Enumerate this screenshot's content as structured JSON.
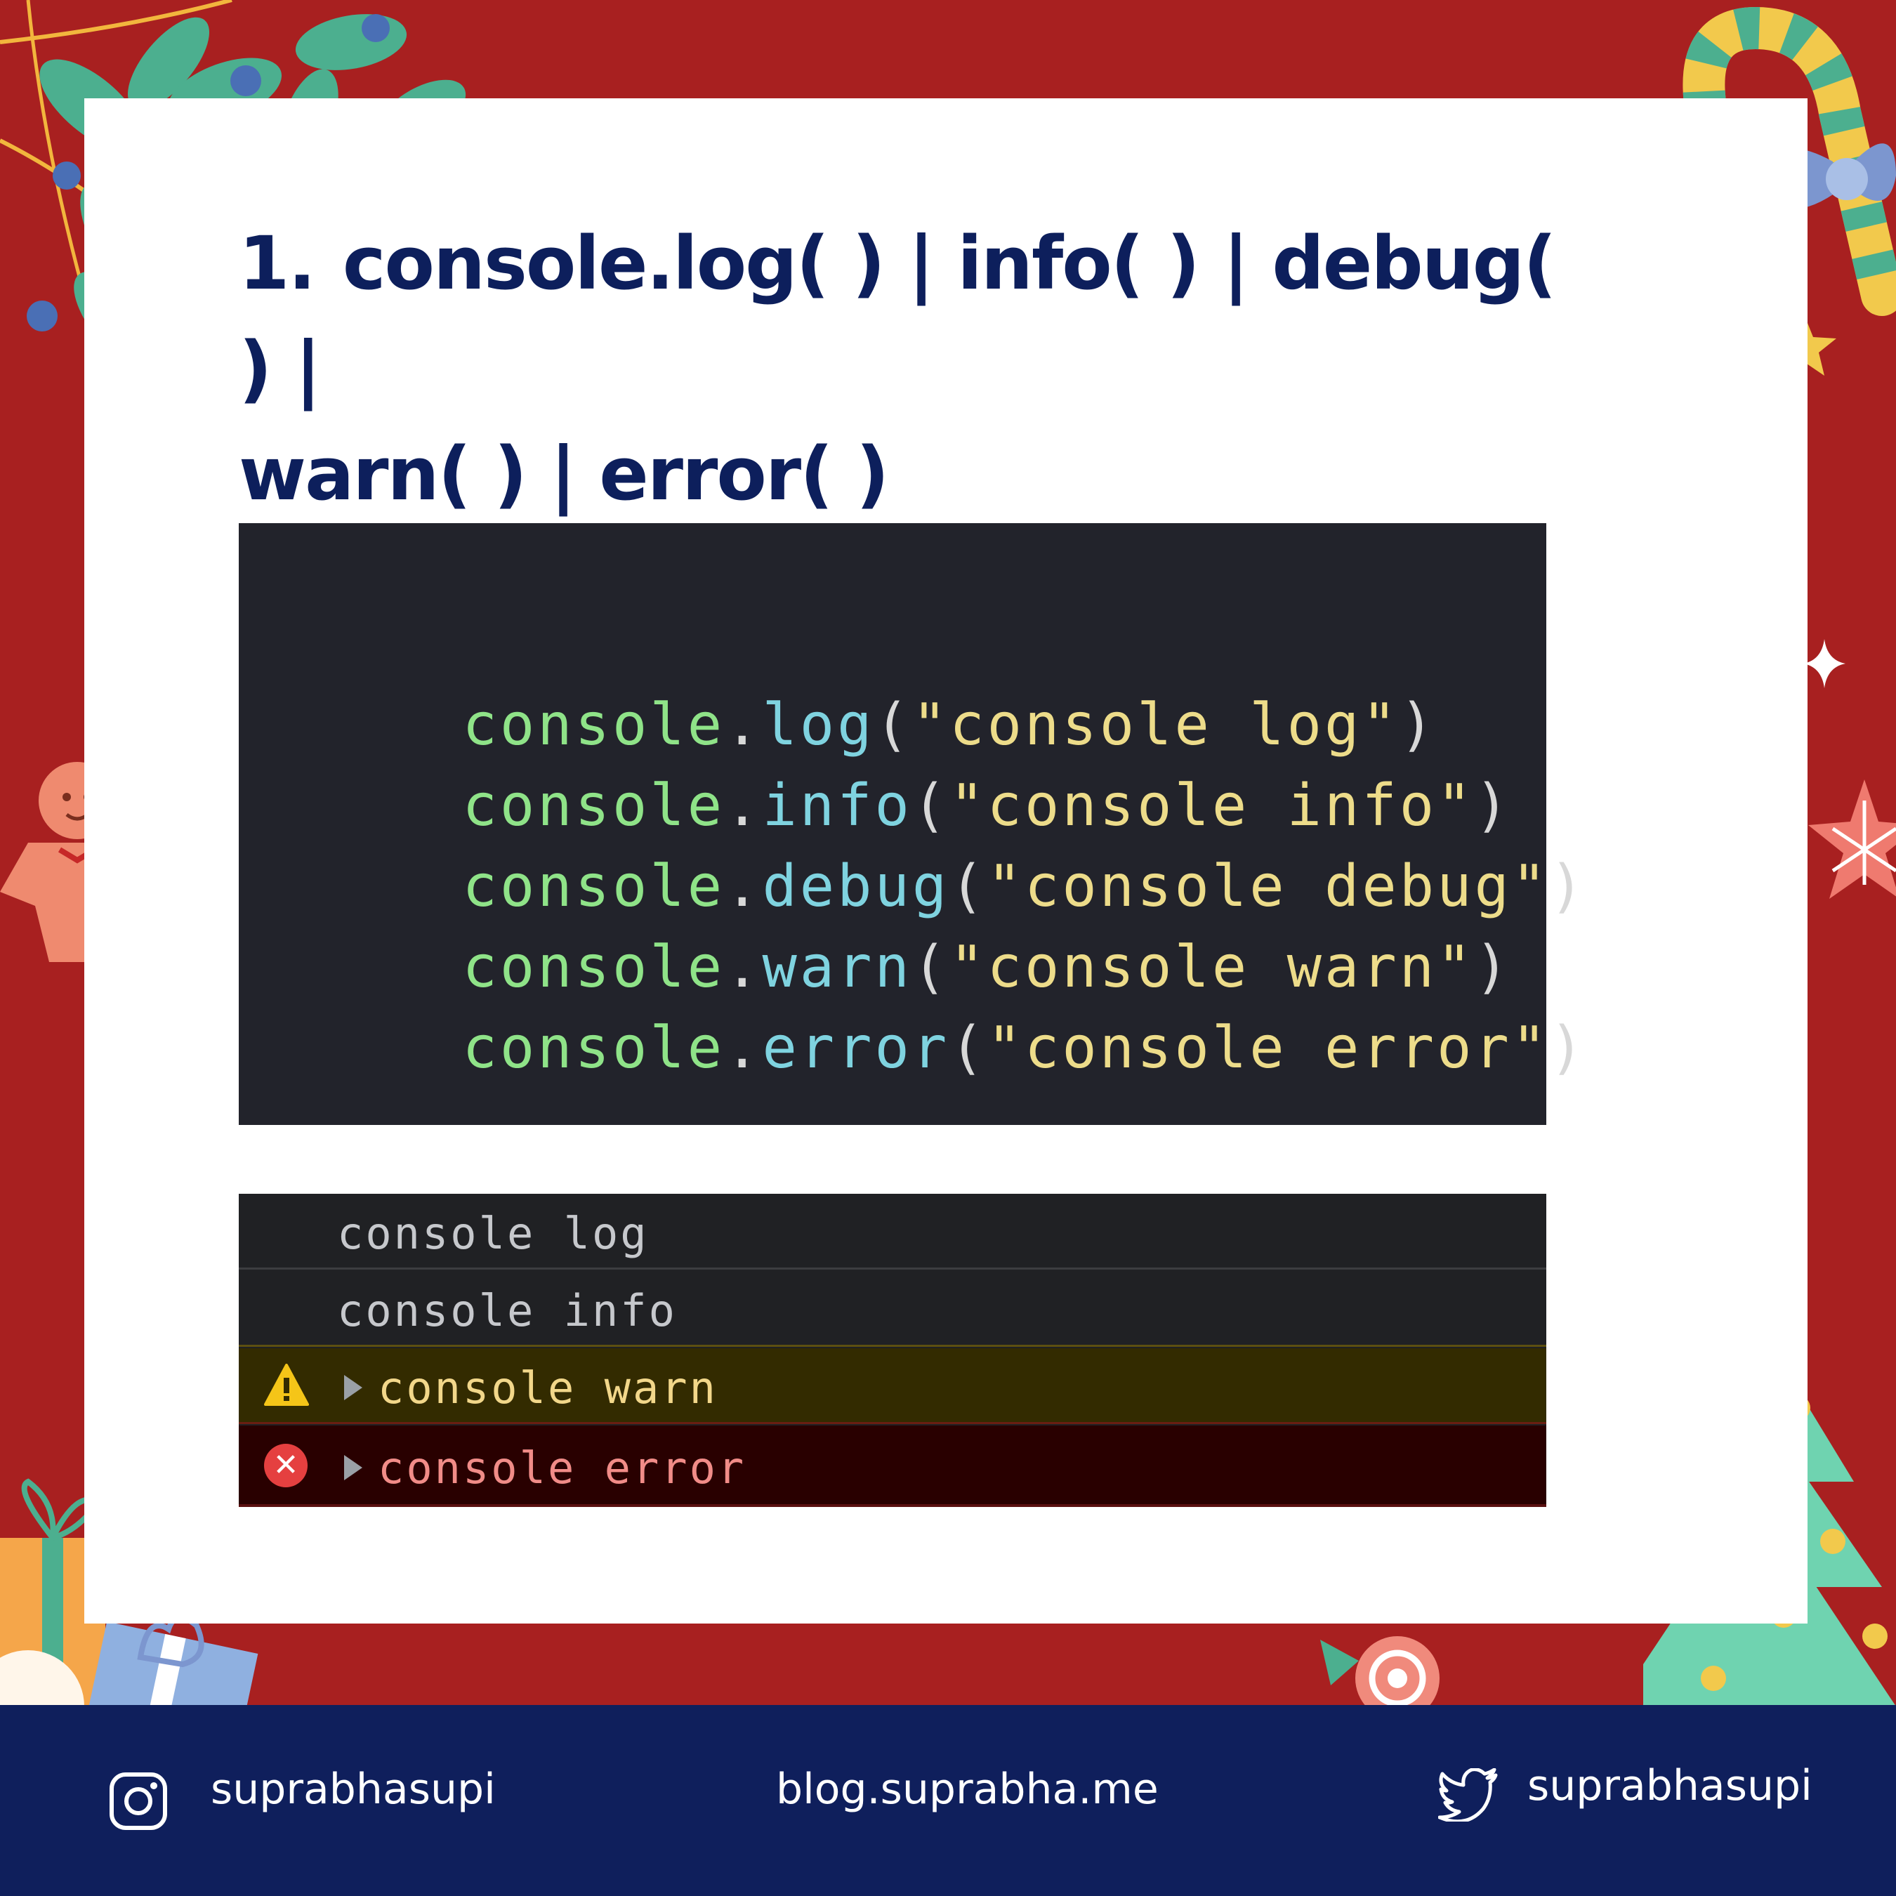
{
  "title": {
    "number": "1.",
    "line1": "console.log( ) | info( ) | debug( ) |",
    "line2": "warn( ) | error( )"
  },
  "code": {
    "lines": [
      {
        "obj": "console",
        "dot": ".",
        "method": "log",
        "open": "(",
        "arg": "\"console log\"",
        "close": ")"
      },
      {
        "obj": "console",
        "dot": ".",
        "method": "info",
        "open": "(",
        "arg": "\"console info\"",
        "close": ")"
      },
      {
        "obj": "console",
        "dot": ".",
        "method": "debug",
        "open": "(",
        "arg": "\"console debug\"",
        "close": ")"
      },
      {
        "obj": "console",
        "dot": ".",
        "method": "warn",
        "open": "(",
        "arg": "\"console warn\"",
        "close": ")"
      },
      {
        "obj": "console",
        "dot": ".",
        "method": "error",
        "open": "(",
        "arg": "\"console error\"",
        "close": ")"
      }
    ]
  },
  "console_output": {
    "rows": [
      {
        "level": "log",
        "text": "console log"
      },
      {
        "level": "info",
        "text": "console info"
      },
      {
        "level": "warn",
        "text": "console warn",
        "icon": "warning-icon"
      },
      {
        "level": "error",
        "text": "console error",
        "icon": "error-icon"
      }
    ]
  },
  "footer": {
    "instagram": "suprabhasupi",
    "blog": "blog.suprabha.me",
    "twitter": "suprabhasupi"
  },
  "colors": {
    "frame_red": "#a82020",
    "navy": "#0f1f5c",
    "title": "#0d1f5c",
    "code_bg": "#22232b",
    "console_bg": "#202124",
    "warn_bg": "#332b00",
    "error_bg": "#290000"
  }
}
